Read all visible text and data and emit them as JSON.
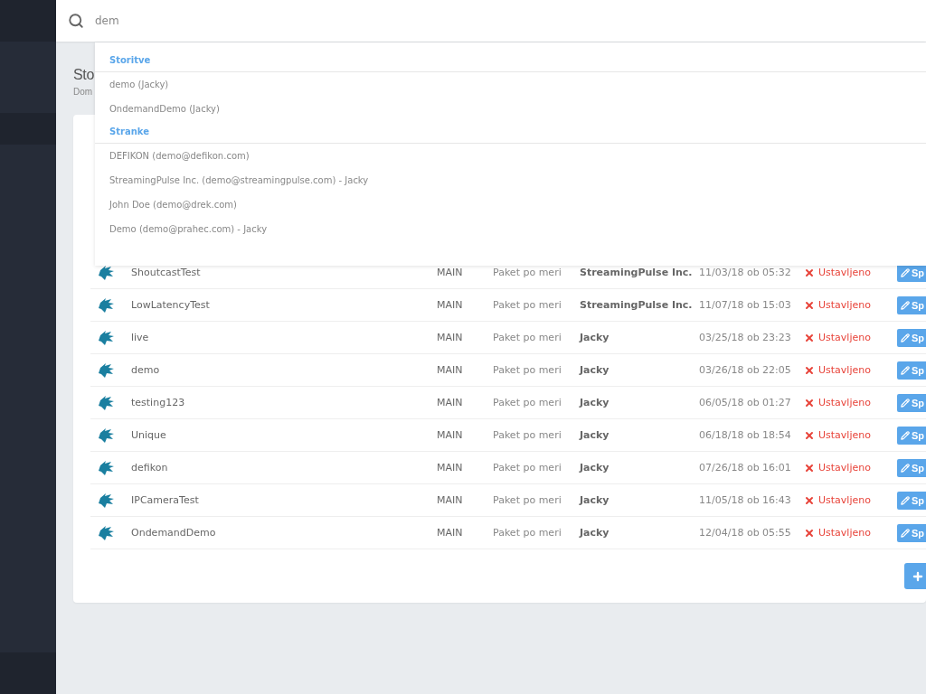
{
  "search": {
    "value": "dem"
  },
  "page": {
    "title": "Sto",
    "subtitle": "Dom"
  },
  "suggestions": [
    {
      "heading": "Storitve",
      "items": [
        "demo (Jacky)",
        "OndemandDemo (Jacky)"
      ]
    },
    {
      "heading": "Stranke",
      "items": [
        "DEFIKON (demo@defikon.com)",
        "StreamingPulse Inc. (demo@streamingpulse.com) - Jacky",
        "John Doe (demo@drek.com)",
        "Demo (demo@prahec.com) - Jacky"
      ]
    }
  ],
  "streams": [
    {
      "name": "ShoutcastTest",
      "server": "MAIN",
      "plan": "Paket po meri",
      "owner": "StreamingPulse Inc.",
      "created": "11/03/18 ob 05:32",
      "status": "Ustavljeno",
      "action": "Sp"
    },
    {
      "name": "LowLatencyTest",
      "server": "MAIN",
      "plan": "Paket po meri",
      "owner": "StreamingPulse Inc.",
      "created": "11/07/18 ob 15:03",
      "status": "Ustavljeno",
      "action": "Sp"
    },
    {
      "name": "live",
      "server": "MAIN",
      "plan": "Paket po meri",
      "owner": "Jacky",
      "created": "03/25/18 ob 23:23",
      "status": "Ustavljeno",
      "action": "Sp"
    },
    {
      "name": "demo",
      "server": "MAIN",
      "plan": "Paket po meri",
      "owner": "Jacky",
      "created": "03/26/18 ob 22:05",
      "status": "Ustavljeno",
      "action": "Sp"
    },
    {
      "name": "testing123",
      "server": "MAIN",
      "plan": "Paket po meri",
      "owner": "Jacky",
      "created": "06/05/18 ob 01:27",
      "status": "Ustavljeno",
      "action": "Sp"
    },
    {
      "name": "Unique",
      "server": "MAIN",
      "plan": "Paket po meri",
      "owner": "Jacky",
      "created": "06/18/18 ob 18:54",
      "status": "Ustavljeno",
      "action": "Sp"
    },
    {
      "name": "defikon",
      "server": "MAIN",
      "plan": "Paket po meri",
      "owner": "Jacky",
      "created": "07/26/18 ob 16:01",
      "status": "Ustavljeno",
      "action": "Sp"
    },
    {
      "name": "IPCameraTest",
      "server": "MAIN",
      "plan": "Paket po meri",
      "owner": "Jacky",
      "created": "11/05/18 ob 16:43",
      "status": "Ustavljeno",
      "action": "Sp"
    },
    {
      "name": "OndemandDemo",
      "server": "MAIN",
      "plan": "Paket po meri",
      "owner": "Jacky",
      "created": "12/04/18 ob 05:55",
      "status": "Ustavljeno",
      "action": "Sp"
    }
  ]
}
